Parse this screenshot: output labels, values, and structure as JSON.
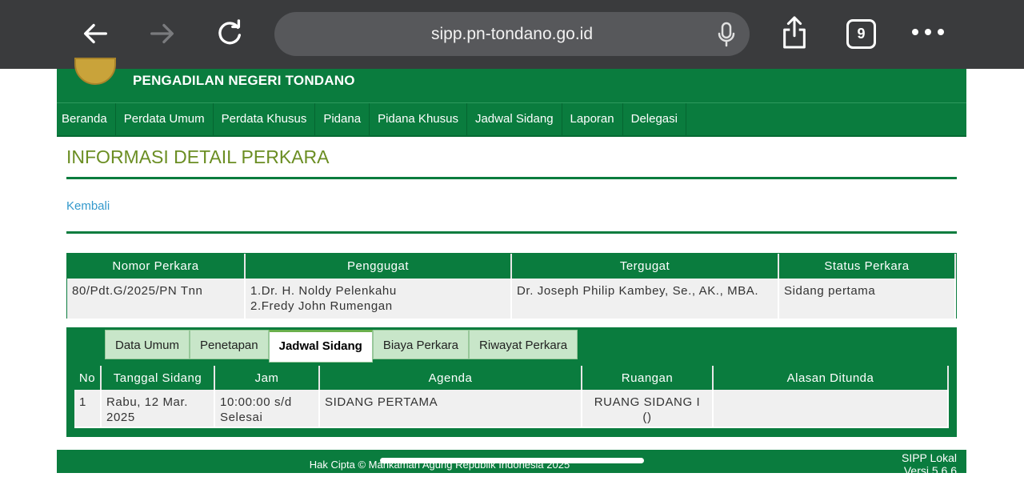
{
  "browser": {
    "url": "sipp.pn-tondano.go.id",
    "tab_count": "9"
  },
  "site": {
    "name": "PENGADILAN NEGERI TONDANO",
    "menu": [
      "Beranda",
      "Perdata Umum",
      "Perdata Khusus",
      "Pidana",
      "Pidana Khusus",
      "Jadwal Sidang",
      "Laporan",
      "Delegasi"
    ]
  },
  "page": {
    "title": "INFORMASI DETAIL PERKARA",
    "back_label": "Kembali"
  },
  "case_table": {
    "headers": [
      "Nomor Perkara",
      "Penggugat",
      "Tergugat",
      "Status Perkara"
    ],
    "row": {
      "nomor": "80/Pdt.G/2025/PN Tnn",
      "penggugat_1": "1.Dr. H. Noldy Pelenkahu",
      "penggugat_2": "2.Fredy John Rumengan",
      "tergugat": "Dr. Joseph Philip Kambey, Se., AK., MBA.",
      "status": "Sidang pertama"
    }
  },
  "tabs": [
    "Data Umum",
    "Penetapan",
    "Jadwal Sidang",
    "Biaya Perkara",
    "Riwayat Perkara"
  ],
  "schedule": {
    "headers": [
      "No",
      "Tanggal Sidang",
      "Jam",
      "Agenda",
      "Ruangan",
      "Alasan Ditunda"
    ],
    "row": {
      "no": "1",
      "tanggal_1": "Rabu, 12 Mar.",
      "tanggal_2": "2025",
      "jam_1": "10:00:00 s/d",
      "jam_2": "Selesai",
      "agenda": "SIDANG PERTAMA",
      "ruangan_1": "RUANG SIDANG I",
      "ruangan_2": "()",
      "alasan": ""
    }
  },
  "footer": {
    "copyright": "Hak Cipta © Mahkamah Agung Republik Indonesia 2025",
    "version_1": "SIPP Lokal",
    "version_2": "Versi 5.6.6"
  }
}
